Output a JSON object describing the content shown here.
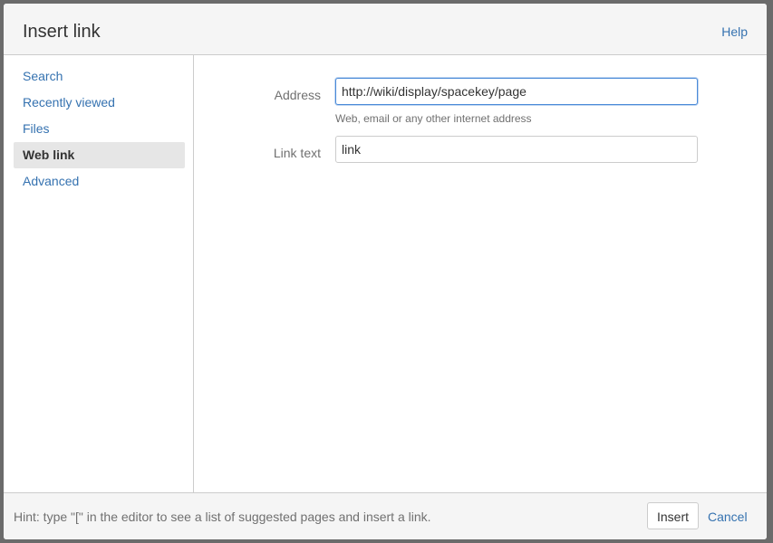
{
  "dialog": {
    "title": "Insert link",
    "help_label": "Help"
  },
  "sidebar": {
    "items": [
      {
        "label": "Search"
      },
      {
        "label": "Recently viewed"
      },
      {
        "label": "Files"
      },
      {
        "label": "Web link",
        "active": true
      },
      {
        "label": "Advanced"
      }
    ]
  },
  "form": {
    "address": {
      "label": "Address",
      "value": "http://wiki/display/spacekey/page",
      "description": "Web, email or any other internet address"
    },
    "link_text": {
      "label": "Link text",
      "value": "link"
    }
  },
  "footer": {
    "hint": "Hint: type \"[\" in the editor to see a list of suggested pages and insert a link.",
    "insert_label": "Insert",
    "cancel_label": "Cancel"
  },
  "colors": {
    "link": "#3572b0",
    "focus_border": "#4a8ad8",
    "active_nav_bg": "#e6e6e6"
  }
}
